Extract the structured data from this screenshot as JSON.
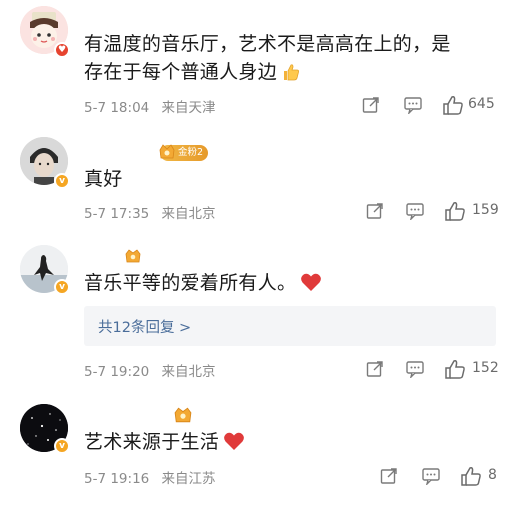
{
  "comments": [
    {
      "text": "有温度的音乐厅，艺术不是高高在上的，是",
      "text2": "存在于每个普通人身边",
      "date": "5-7 18:04",
      "location": "来自天津",
      "likes": "645",
      "emoji": "thumbs-up-emoji"
    },
    {
      "text": "真好",
      "fan_badge": "金粉2",
      "date": "5-7 17:35",
      "location": "来自北京",
      "likes": "159"
    },
    {
      "text": "音乐平等的爱着所有人。",
      "emoji": "red-heart-emoji",
      "replies_label": "共12条回复 >",
      "date": "5-7 19:20",
      "location": "来自北京",
      "likes": "152"
    },
    {
      "text": "艺术来源于生活",
      "emoji": "red-heart-emoji",
      "date": "5-7 19:16",
      "location": "来自江苏",
      "likes": "8"
    }
  ],
  "icons": {
    "share": "share-icon",
    "comment": "comment-icon",
    "like": "like-icon"
  },
  "colors": {
    "meta": "#8a8a8a",
    "reply_link": "#4a6d9a",
    "badge_gold": "#f5a623",
    "badge_red": "#e6432f",
    "heart": "#e03a3a"
  }
}
